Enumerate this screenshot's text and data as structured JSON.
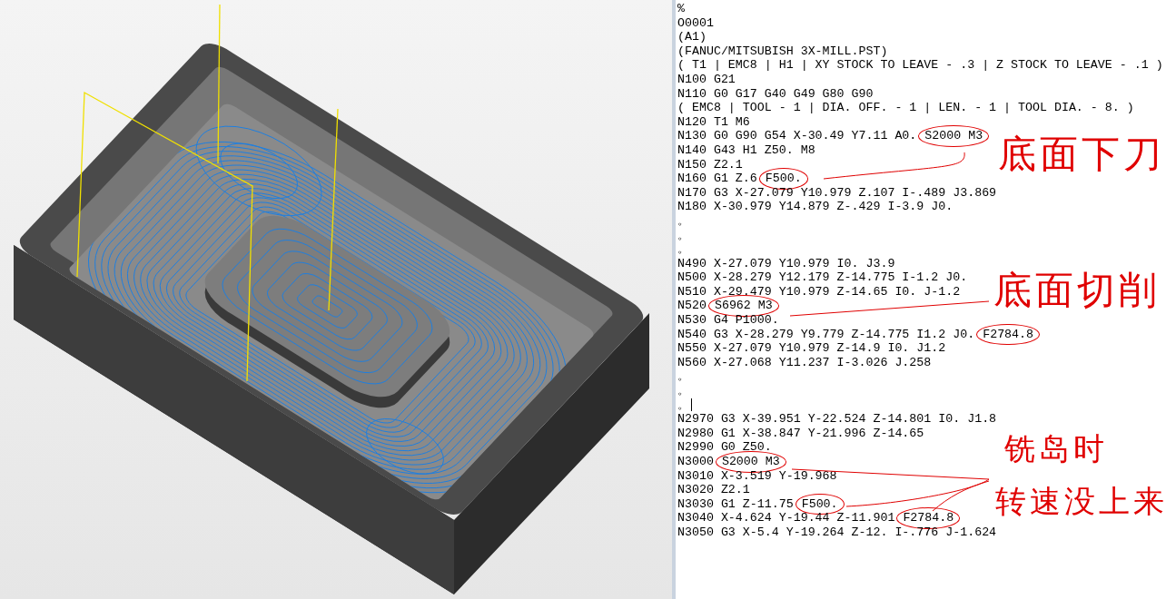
{
  "code_listing": {
    "lines": [
      {
        "code": "%",
        "cursor": false
      },
      {
        "code": "O0001",
        "cursor": false
      },
      {
        "code": "(A1)",
        "cursor": false
      },
      {
        "code": "(FANUC/MITSUBISH 3X-MILL.PST)",
        "cursor": false
      },
      {
        "code": "( T1 | EMC8 | H1 | XY STOCK TO LEAVE - .3 | Z STOCK TO LEAVE - .1 )",
        "cursor": false
      },
      {
        "code": "N100 G21",
        "cursor": false
      },
      {
        "code": "N110 G0 G17 G40 G49 G80 G90",
        "cursor": false
      },
      {
        "code": "( EMC8 | TOOL - 1 | DIA. OFF. - 1 | LEN. - 1 | TOOL DIA. - 8. )",
        "cursor": false
      },
      {
        "code": "N120 T1 M6",
        "cursor": false
      },
      {
        "code": "N130 G0 G90 G54 X-30.49 Y7.11 A0.",
        "circled": "S2000 M3",
        "cursor": false
      },
      {
        "code": "N140 G43 H1 Z50. M8",
        "cursor": false
      },
      {
        "code": "N150 Z2.1",
        "cursor": false
      },
      {
        "code": "N160 G1 Z.6",
        "circled": "F500.",
        "cursor": false
      },
      {
        "code": "N170 G3 X-27.079 Y10.979 Z.107 I-.489 J3.869",
        "cursor": false
      },
      {
        "code": "N180 X-30.979 Y14.879 Z-.429 I-3.9 J0.",
        "cursor": false
      },
      {
        "code": "。",
        "cursor": false
      },
      {
        "code": "。",
        "cursor": false
      },
      {
        "code": "。",
        "cursor": false
      },
      {
        "code": "N490 X-27.079 Y10.979 I0. J3.9",
        "cursor": false
      },
      {
        "code": "N500 X-28.279 Y12.179 Z-14.775 I-1.2 J0.",
        "cursor": false
      },
      {
        "code": "N510 X-29.479 Y10.979 Z-14.65 I0. J-1.2",
        "cursor": false
      },
      {
        "code": "N520",
        "circled": "S6962 M3",
        "cursor": false
      },
      {
        "code": "N530 G4 P1000.",
        "cursor": false
      },
      {
        "code": "N540 G3 X-28.279 Y9.779 Z-14.775 I1.2 J0.",
        "circled": "F2784.8",
        "cursor": false
      },
      {
        "code": "N550 X-27.079 Y10.979 Z-14.9 I0. J1.2",
        "cursor": false
      },
      {
        "code": "N560 X-27.068 Y11.237 I-3.026 J.258",
        "cursor": false
      },
      {
        "code": "。",
        "cursor": false
      },
      {
        "code": "。",
        "cursor": false
      },
      {
        "code": "。",
        "cursor": true
      },
      {
        "code": "N2970 G3 X-39.951 Y-22.524 Z-14.801 I0. J1.8",
        "cursor": false
      },
      {
        "code": "N2980 G1 X-38.847 Y-21.996 Z-14.65",
        "cursor": false
      },
      {
        "code": "N2990 G0 Z50.",
        "cursor": false
      },
      {
        "code": "N3000",
        "circled": "S2000 M3",
        "cursor": false
      },
      {
        "code": "N3010 X-3.519 Y-19.968",
        "cursor": false
      },
      {
        "code": "N3020 Z2.1",
        "cursor": false
      },
      {
        "code": "N3030 G1 Z-11.75",
        "circled": "F500.",
        "cursor": false
      },
      {
        "code": "N3040 X-4.624 Y-19.44 Z-11.901",
        "circled": "F2784.8",
        "cursor": false
      },
      {
        "code": "N3050 G3 X-5.4 Y-19.264 Z-12. I-.776 J-1.624",
        "cursor": false
      }
    ]
  },
  "annotations": [
    {
      "text": "底面下刀"
    },
    {
      "text": "底面切削"
    },
    {
      "text": "铣岛时"
    },
    {
      "text": "转速没上来"
    }
  ]
}
